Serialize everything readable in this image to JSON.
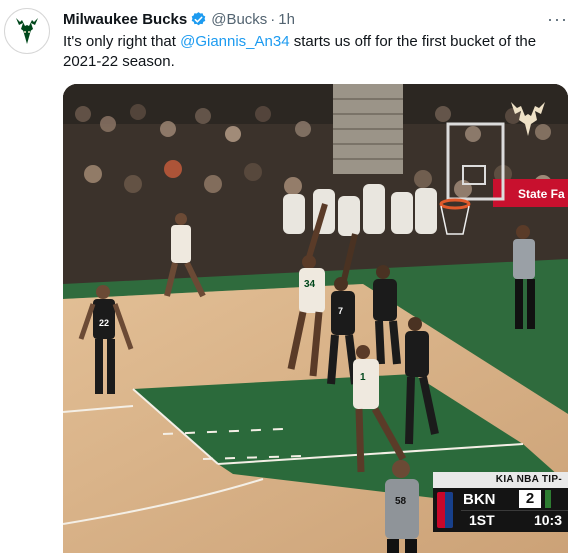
{
  "tweet": {
    "display_name": "Milwaukee Bucks",
    "handle": "@Bucks",
    "separator": "·",
    "time": "1h",
    "more_label": "···",
    "text_before": "It's only right that ",
    "mention": "@Giannis_An34",
    "text_after": " starts us off for the first bucket of the 2021-22 season."
  },
  "video": {
    "court_sign": "State Fa",
    "player_numbers": [
      "34",
      "7",
      "22",
      "1",
      "58"
    ],
    "scoreboard": {
      "header": "KIA NBA TIP-",
      "team": "BKN",
      "score": "2",
      "period": "1ST",
      "clock": "10:3"
    }
  },
  "colors": {
    "link": "#1d9bf0",
    "verified": "#1d9bf0",
    "bucks_green": "#00471b",
    "muted_text": "#536471"
  },
  "icons": [
    "bucks-logo-icon",
    "verified-badge-icon",
    "more-icon",
    "nba-logo-icon"
  ]
}
